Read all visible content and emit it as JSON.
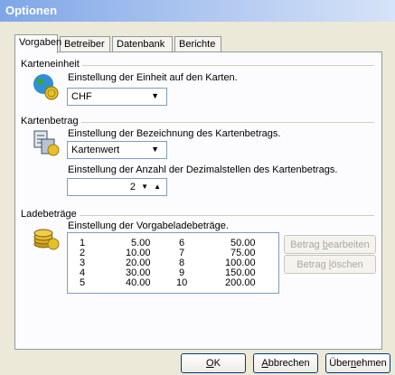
{
  "window": {
    "title": "Optionen"
  },
  "tabs": [
    {
      "label": "Vorgaben",
      "active": true
    },
    {
      "label": "Betreiber",
      "active": false
    },
    {
      "label": "Datenbank",
      "active": false
    },
    {
      "label": "Berichte",
      "active": false
    }
  ],
  "karteneinheit": {
    "group_title": "Karteneinheit",
    "description": "Einstellung der Einheit auf den Karten.",
    "currency_value": "CHF",
    "icon": "globe-coin-icon"
  },
  "kartenbetrag": {
    "group_title": "Kartenbetrag",
    "description": "Einstellung der Bezeichnung des Kartenbetrags.",
    "name_value": "Kartenwert",
    "decimals_description": "Einstellung der Anzahl der Dezimalstellen des Kartenbetrags.",
    "decimals_value": "2",
    "icon": "cash-register-icon"
  },
  "ladebetraege": {
    "group_title": "Ladebeträge",
    "description": "Einstellung der Vorgabeladebeträge.",
    "icon": "coin-stack-icon",
    "left_column": [
      {
        "n": "1",
        "amount": "5.00"
      },
      {
        "n": "2",
        "amount": "10.00"
      },
      {
        "n": "3",
        "amount": "20.00"
      },
      {
        "n": "4",
        "amount": "30.00"
      },
      {
        "n": "5",
        "amount": "40.00"
      }
    ],
    "right_column": [
      {
        "n": "6",
        "amount": "50.00"
      },
      {
        "n": "7",
        "amount": "75.00"
      },
      {
        "n": "8",
        "amount": "100.00"
      },
      {
        "n": "9",
        "amount": "150.00"
      },
      {
        "n": "10",
        "amount": "200.00"
      }
    ],
    "edit_button": {
      "pre": "Betrag ",
      "key": "b",
      "post": "earbeiten"
    },
    "delete_button": {
      "pre": "Betrag ",
      "key": "l",
      "post": "öschen"
    }
  },
  "buttons": {
    "ok": {
      "pre": "",
      "key": "O",
      "post": "K"
    },
    "cancel": {
      "pre": "",
      "key": "A",
      "post": "bbrechen"
    },
    "apply": {
      "pre": "Über",
      "key": "n",
      "post": "ehmen"
    }
  },
  "colors": {
    "titlebar_start": "#7fa6e8",
    "titlebar_end": "#d6e3f8",
    "dialog_bg": "#ece9d8",
    "panel_bg": "#fcfcfe",
    "border": "#919b9c",
    "disabled_text": "#aca899"
  }
}
